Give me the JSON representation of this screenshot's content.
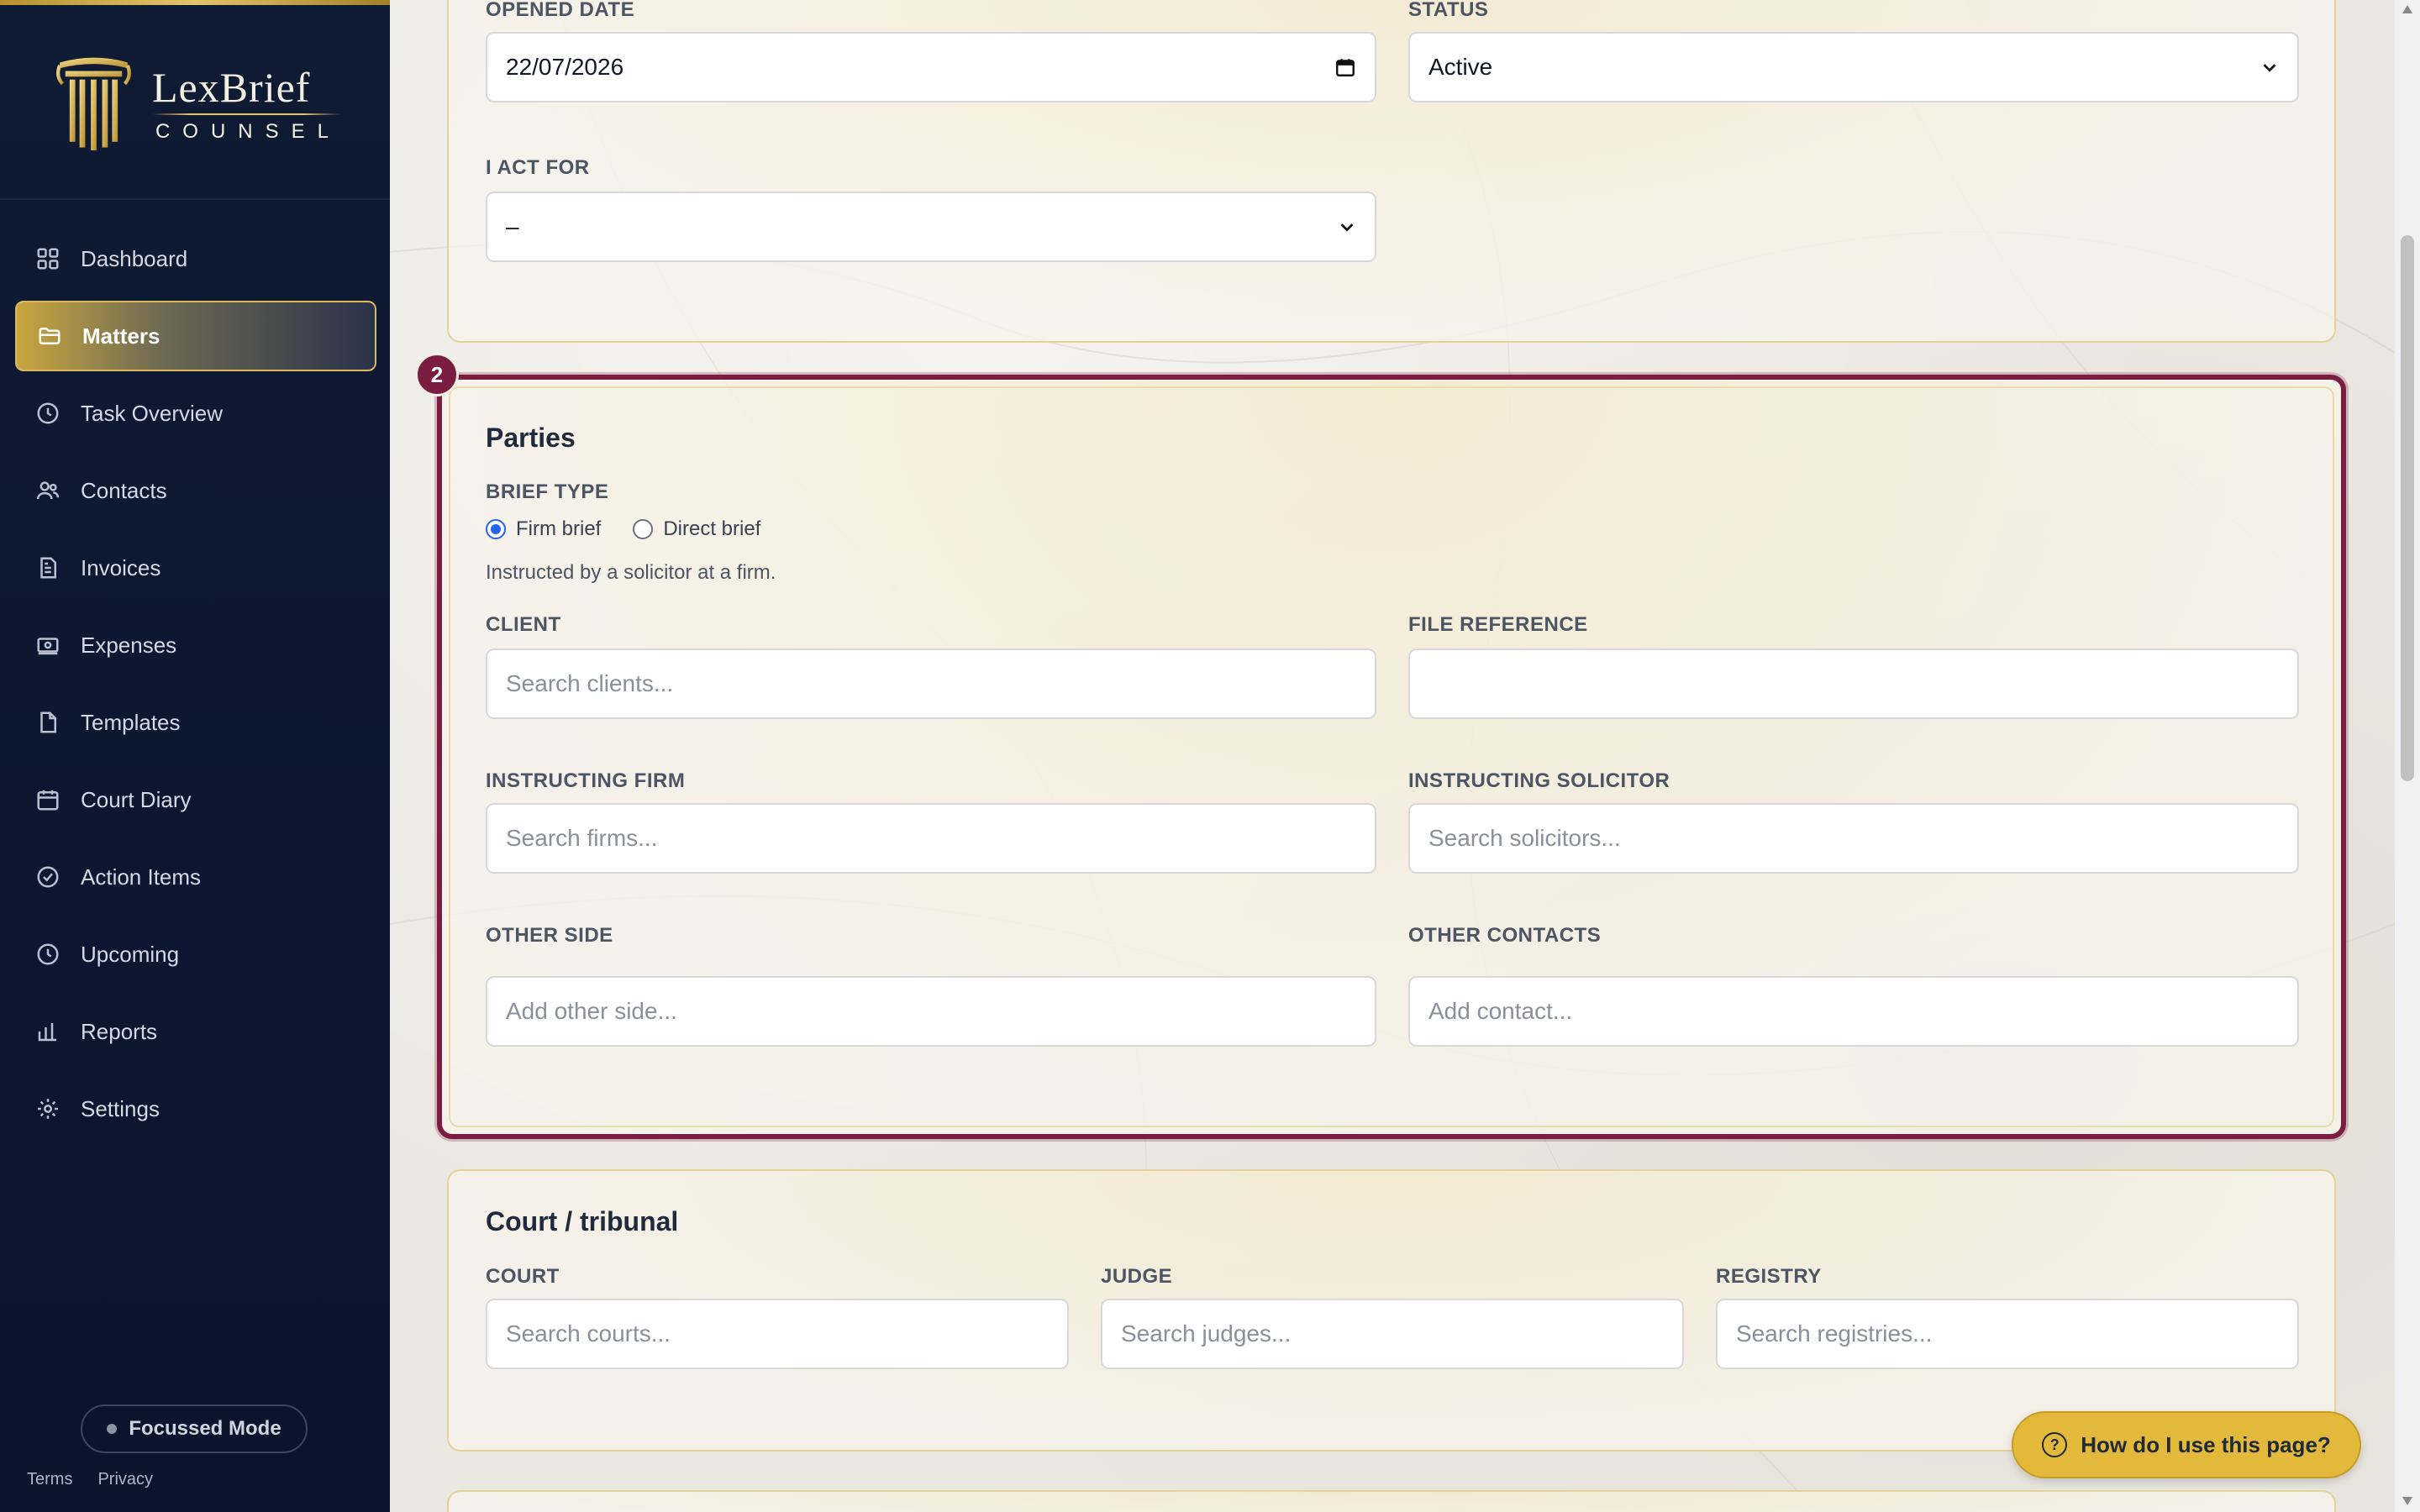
{
  "app": {
    "logo_name": "LexBrief",
    "logo_sub": "COUNSEL"
  },
  "sidebar": {
    "items": [
      {
        "label": "Dashboard",
        "icon": "grid-icon"
      },
      {
        "label": "Matters",
        "icon": "folder-icon",
        "active": true
      },
      {
        "label": "Task Overview",
        "icon": "clock-icon"
      },
      {
        "label": "Contacts",
        "icon": "users-icon"
      },
      {
        "label": "Invoices",
        "icon": "invoice-icon"
      },
      {
        "label": "Expenses",
        "icon": "money-icon"
      },
      {
        "label": "Templates",
        "icon": "file-icon"
      },
      {
        "label": "Court Diary",
        "icon": "calendar-icon"
      },
      {
        "label": "Action Items",
        "icon": "check-circle-icon"
      },
      {
        "label": "Upcoming",
        "icon": "clock-icon"
      },
      {
        "label": "Reports",
        "icon": "bar-chart-icon"
      },
      {
        "label": "Settings",
        "icon": "gear-icon"
      }
    ],
    "focus_mode": "Focussed Mode",
    "terms": "Terms",
    "privacy": "Privacy"
  },
  "matter_details": {
    "opened_date_label": "OPENED DATE",
    "opened_date_value": "22/07/2026",
    "status_label": "STATUS",
    "status_value": "Active",
    "act_for_label": "I ACT FOR",
    "act_for_value": "–"
  },
  "parties": {
    "step": "2",
    "title": "Parties",
    "brief_type_label": "BRIEF TYPE",
    "brief_options": [
      "Firm brief",
      "Direct brief"
    ],
    "brief_selected": "Firm brief",
    "helper": "Instructed by a solicitor at a firm.",
    "client_label": "CLIENT",
    "client_placeholder": "Search clients...",
    "file_ref_label": "FILE REFERENCE",
    "file_ref_value": "",
    "firm_label": "INSTRUCTING FIRM",
    "firm_placeholder": "Search firms...",
    "solicitor_label": "INSTRUCTING SOLICITOR",
    "solicitor_placeholder": "Search solicitors...",
    "other_side_label": "OTHER SIDE",
    "other_side_placeholder": "Add other side...",
    "other_contacts_label": "OTHER CONTACTS",
    "other_contacts_placeholder": "Add contact..."
  },
  "court": {
    "title": "Court / tribunal",
    "court_label": "COURT",
    "court_placeholder": "Search courts...",
    "judge_label": "JUDGE",
    "judge_placeholder": "Search judges...",
    "registry_label": "REGISTRY",
    "registry_placeholder": "Search registries..."
  },
  "help_button": "How do I use this page?",
  "colors": {
    "sidebar_bg": "#0f1a33",
    "gold_accent": "#e2c46a",
    "highlight_border": "#7b1d41",
    "help_button_bg": "#e2b93b"
  }
}
